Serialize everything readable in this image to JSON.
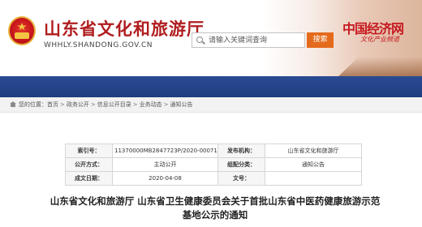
{
  "header": {
    "site_title": "山东省文化和旅游厅",
    "site_domain": "WHHLY.SHANDONG.GOV.CN",
    "search_placeholder": "请输入关键词查询",
    "search_button": "搜索",
    "partner_name": "中国经济网",
    "partner_sub": "文化产业频道"
  },
  "breadcrumb": {
    "prefix": "您的位置：",
    "items": [
      "首页",
      "政务公开",
      "信息公开目录",
      "业务动态",
      "通知公告"
    ],
    "separator": ">"
  },
  "info": {
    "index_label": "索引号：",
    "index_value": "11370000MB2847723P/2020-00071",
    "org_label": "发布机构：",
    "org_value": "山东省文化和旅游厅",
    "method_label": "公开方式：",
    "method_value": "主动公开",
    "category_label": "组配分类：",
    "category_value": "通知公告",
    "date_label": "成文日期：",
    "date_value": "2020-04-08",
    "docno_label": "文号：",
    "docno_value": ""
  },
  "article": {
    "title_line1": "山东省文化和旅游厅 山东省卫生健康委员会关于首批山东省中医药健康旅游示范",
    "title_line2": "基地公示的通知"
  },
  "colors": {
    "title_red": "#b01d1f",
    "banner_blue": "#1f3d80",
    "search_orange": "#e46a1c"
  }
}
